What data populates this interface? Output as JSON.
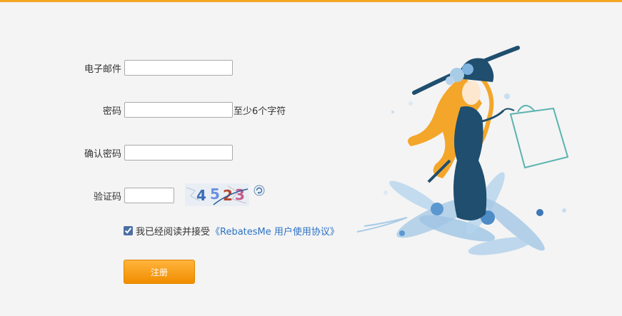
{
  "form": {
    "email_label": "电子邮件",
    "email_value": "",
    "password_label": "密码",
    "password_value": "",
    "password_hint": "至少6个字符",
    "confirm_label": "确认密码",
    "confirm_value": "",
    "captcha_label": "验证码",
    "captcha_value": "",
    "captcha_digits": [
      "4",
      "5",
      "2",
      "3"
    ],
    "agree_checked": true,
    "agree_text": "我已经阅读并接受",
    "agree_link": "《RebatesMe 用户使用协议》",
    "register_label": "注册"
  },
  "colors": {
    "accent": "#f5a623",
    "link": "#2b72c4",
    "button_top": "#ffb43c",
    "button_bottom": "#f18d00"
  },
  "icons": {
    "refresh": "refresh-icon",
    "illustration": "shopping-woman-illustration"
  }
}
